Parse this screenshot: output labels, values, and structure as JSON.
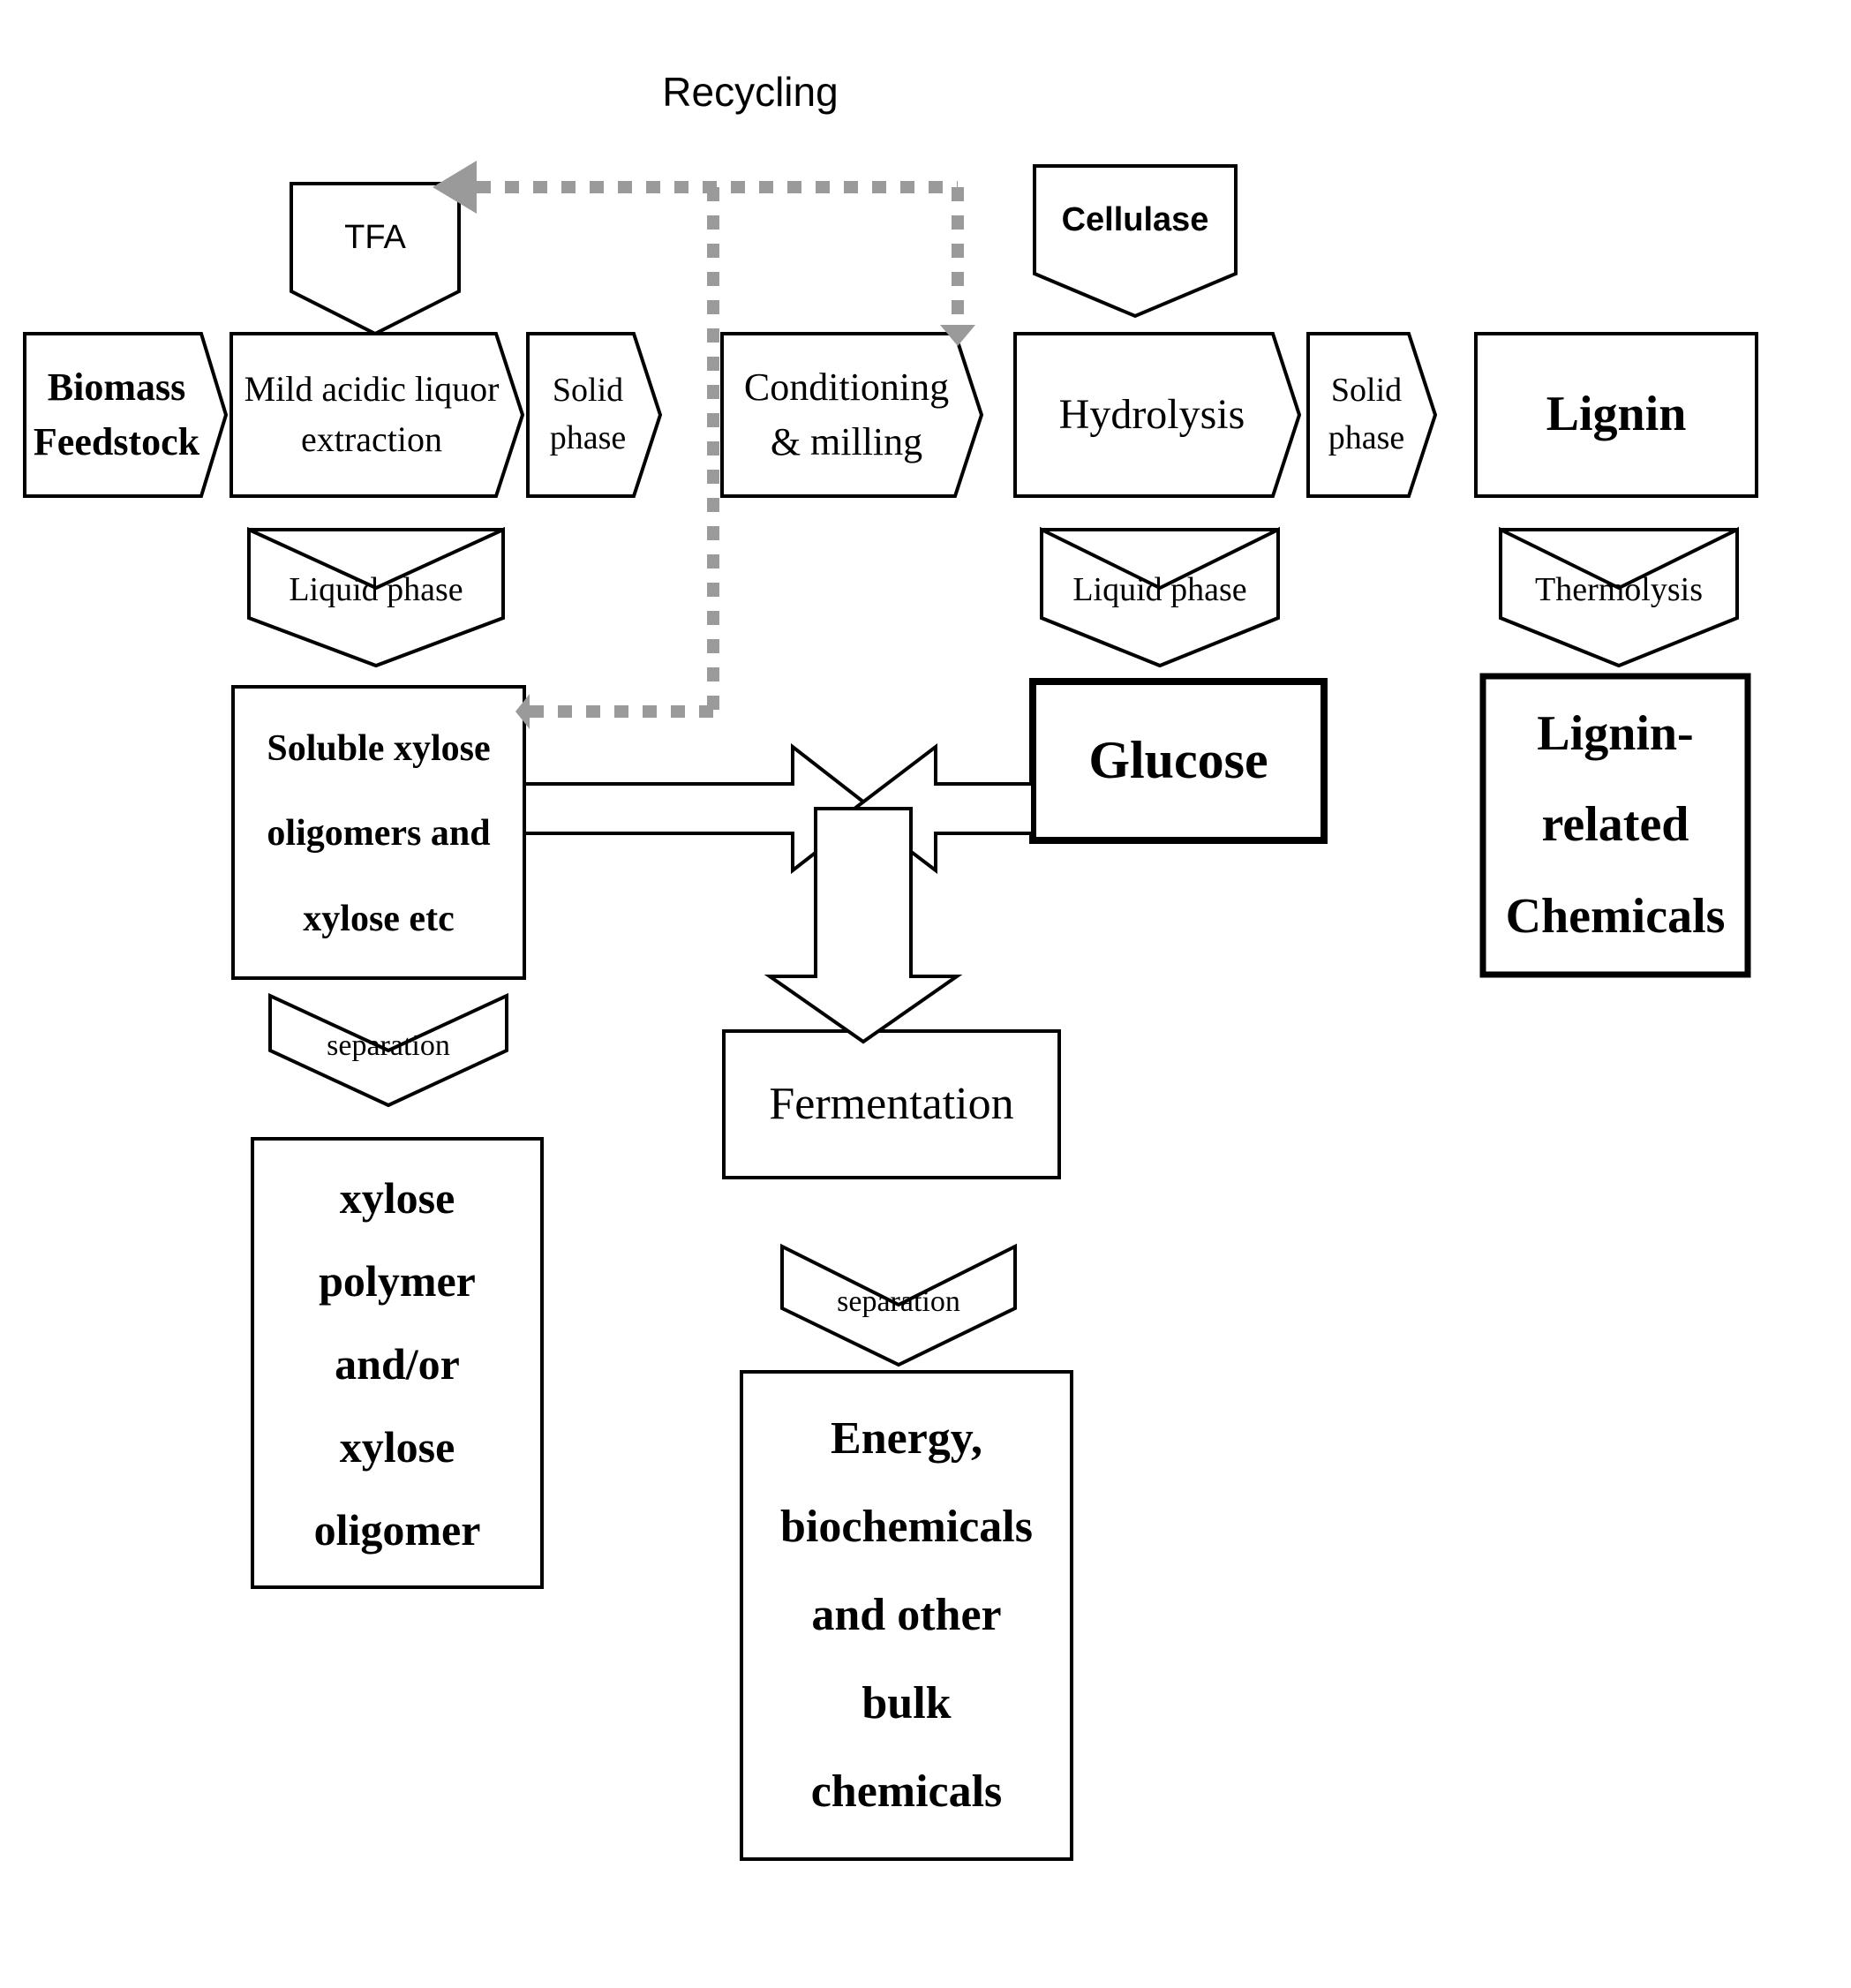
{
  "diagram": {
    "title": "Recycling",
    "type": "process-flow-diagram",
    "nodes": {
      "tfa": "TFA",
      "cellulase": "Cellulase",
      "biomass_feedstock": "Biomass\nFeedstock",
      "mild_acidic_liquor_extraction": "Mild acidic liquor\nextraction",
      "solid_phase_1": "Solid\nphase",
      "conditioning_milling": "Conditioning\n& milling",
      "hydrolysis": "Hydrolysis",
      "solid_phase_2": "Solid\nphase",
      "lignin": "Lignin",
      "liquid_phase_1": "Liquid phase",
      "liquid_phase_2": "Liquid phase",
      "thermolysis": "Thermolysis",
      "soluble_xylose": "Soluble xylose\noligomers and\nxylose etc",
      "glucose": "Glucose",
      "lignin_related_chemicals": "Lignin-\nrelated\nChemicals",
      "separation_left": "separation",
      "separation_mid": "separation",
      "xylose_polymer": "xylose\npolymer\nand/or\nxylose\noligomer",
      "fermentation": "Fermentation",
      "energy_biochemicals": "Energy,\nbiochemicals\nand other\nbulk\nchemicals"
    },
    "node_lines": {
      "biomass_feedstock": [
        "Biomass",
        "Feedstock"
      ],
      "mild_acidic_liquor_extraction": [
        "Mild acidic liquor",
        "extraction"
      ],
      "solid_phase_1": [
        "Solid",
        "phase"
      ],
      "conditioning_milling": [
        "Conditioning",
        "& milling"
      ],
      "solid_phase_2": [
        "Solid",
        "phase"
      ],
      "soluble_xylose": [
        "Soluble xylose",
        "oligomers and",
        "xylose etc"
      ],
      "lignin_related_chemicals": [
        "Lignin-",
        "related",
        "Chemicals"
      ],
      "xylose_polymer": [
        "xylose",
        "polymer",
        "and/or",
        "xylose",
        "oligomer"
      ],
      "energy_biochemicals": [
        "Energy,",
        "biochemicals",
        "and other",
        "bulk",
        "chemicals"
      ]
    },
    "colors": {
      "stroke": "#000000",
      "fill": "#ffffff",
      "dashed": "#9a9a9a",
      "background": "#ffffff"
    }
  }
}
